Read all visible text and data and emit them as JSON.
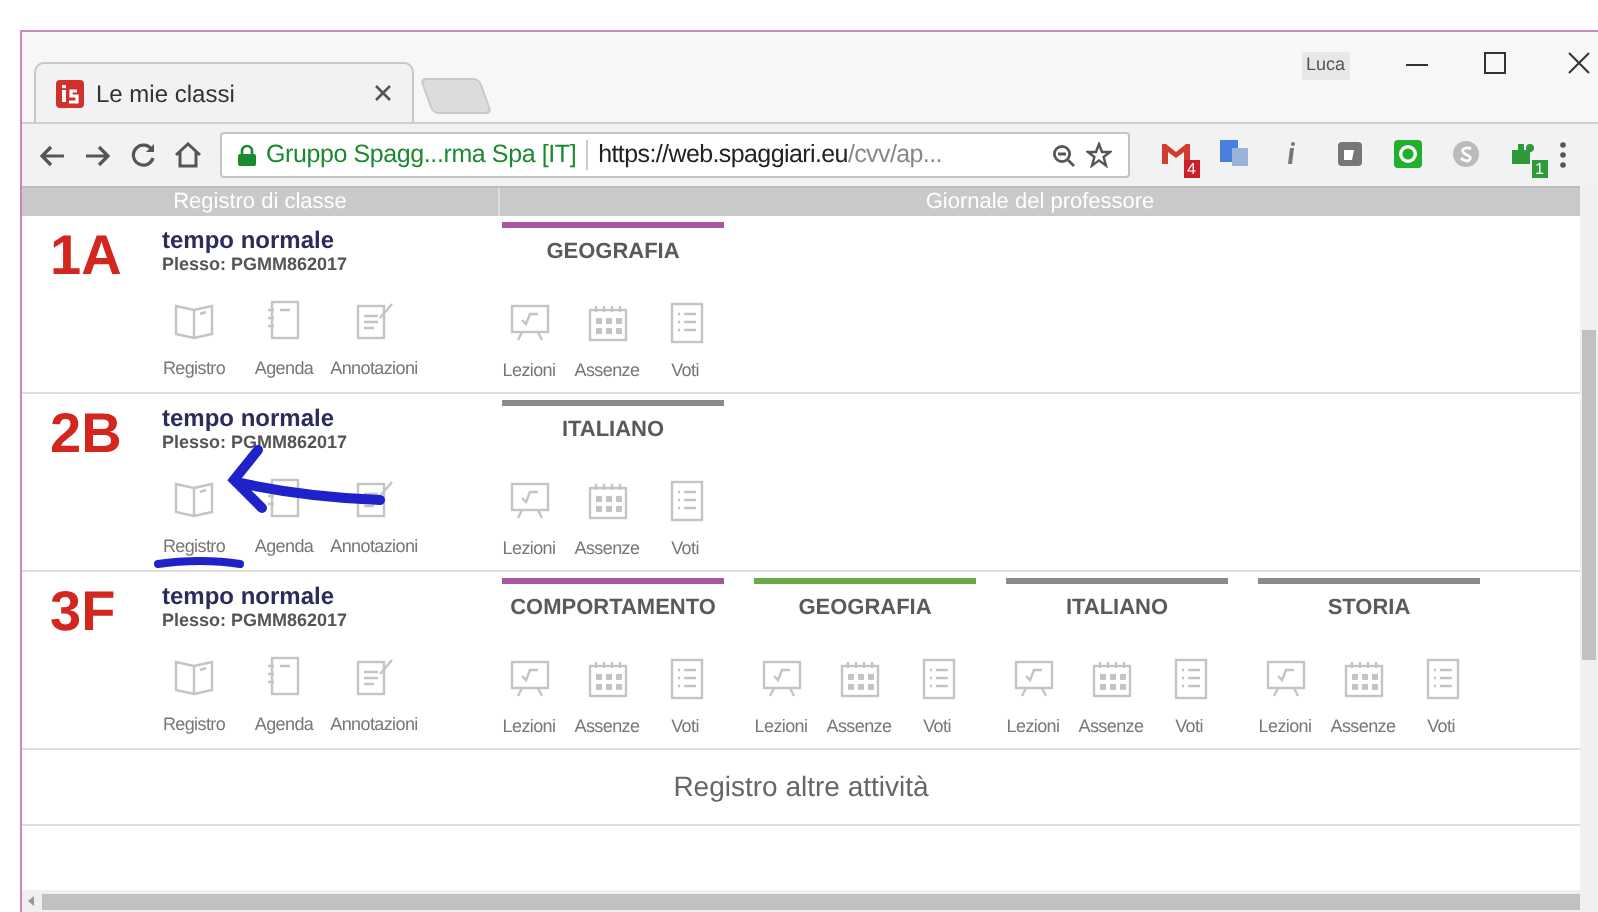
{
  "browser": {
    "tab_title": "Le mie classi",
    "profile": "Luca",
    "site_name": "Gruppo Spagg...rma Spa [IT]",
    "url_host": "https://web.spaggiari.eu",
    "url_path": "/cvv/ap...",
    "extensions": [
      {
        "kind": "mail",
        "badge": "4"
      },
      {
        "kind": "translate"
      },
      {
        "kind": "info"
      },
      {
        "kind": "square"
      },
      {
        "kind": "chat"
      },
      {
        "kind": "skype"
      },
      {
        "kind": "puzzle",
        "badge": "1"
      }
    ]
  },
  "header": {
    "left": "Registro di classe",
    "right": "Giornale del professore"
  },
  "classes": [
    {
      "name": "1A",
      "schedule": "tempo normale",
      "plesso": "Plesso: PGMM862017",
      "tools": [
        {
          "kind": "book",
          "label": "Registro"
        },
        {
          "kind": "agenda",
          "label": "Agenda"
        },
        {
          "kind": "notes",
          "label": "Annotazioni"
        }
      ],
      "subjects": [
        {
          "name": "GEOGRAFIA",
          "color": "#a5579f",
          "tools": [
            {
              "kind": "board",
              "label": "Lezioni"
            },
            {
              "kind": "calendar",
              "label": "Assenze"
            },
            {
              "kind": "list",
              "label": "Voti"
            }
          ]
        }
      ]
    },
    {
      "name": "2B",
      "schedule": "tempo normale",
      "plesso": "Plesso: PGMM862017",
      "tools": [
        {
          "kind": "book",
          "label": "Registro"
        },
        {
          "kind": "agenda",
          "label": "Agenda"
        },
        {
          "kind": "notes",
          "label": "Annotazioni"
        }
      ],
      "subjects": [
        {
          "name": "ITALIANO",
          "color": "#8a8a8a",
          "tools": [
            {
              "kind": "board",
              "label": "Lezioni"
            },
            {
              "kind": "calendar",
              "label": "Assenze"
            },
            {
              "kind": "list",
              "label": "Voti"
            }
          ]
        }
      ]
    },
    {
      "name": "3F",
      "schedule": "tempo normale",
      "plesso": "Plesso: PGMM862017",
      "tools": [
        {
          "kind": "book",
          "label": "Registro"
        },
        {
          "kind": "agenda",
          "label": "Agenda"
        },
        {
          "kind": "notes",
          "label": "Annotazioni"
        }
      ],
      "subjects": [
        {
          "name": "COMPORTAMENTO",
          "color": "#a5579f",
          "tools": [
            {
              "kind": "board",
              "label": "Lezioni"
            },
            {
              "kind": "calendar",
              "label": "Assenze"
            },
            {
              "kind": "list",
              "label": "Voti"
            }
          ]
        },
        {
          "name": "GEOGRAFIA",
          "color": "#6aab45",
          "tools": [
            {
              "kind": "board",
              "label": "Lezioni"
            },
            {
              "kind": "calendar",
              "label": "Assenze"
            },
            {
              "kind": "list",
              "label": "Voti"
            }
          ]
        },
        {
          "name": "ITALIANO",
          "color": "#8a8a8a",
          "tools": [
            {
              "kind": "board",
              "label": "Lezioni"
            },
            {
              "kind": "calendar",
              "label": "Assenze"
            },
            {
              "kind": "list",
              "label": "Voti"
            }
          ]
        },
        {
          "name": "STORIA",
          "color": "#8a8a8a",
          "tools": [
            {
              "kind": "board",
              "label": "Lezioni"
            },
            {
              "kind": "calendar",
              "label": "Assenze"
            },
            {
              "kind": "list",
              "label": "Voti"
            }
          ]
        }
      ]
    }
  ],
  "footer_link": "Registro altre attività"
}
